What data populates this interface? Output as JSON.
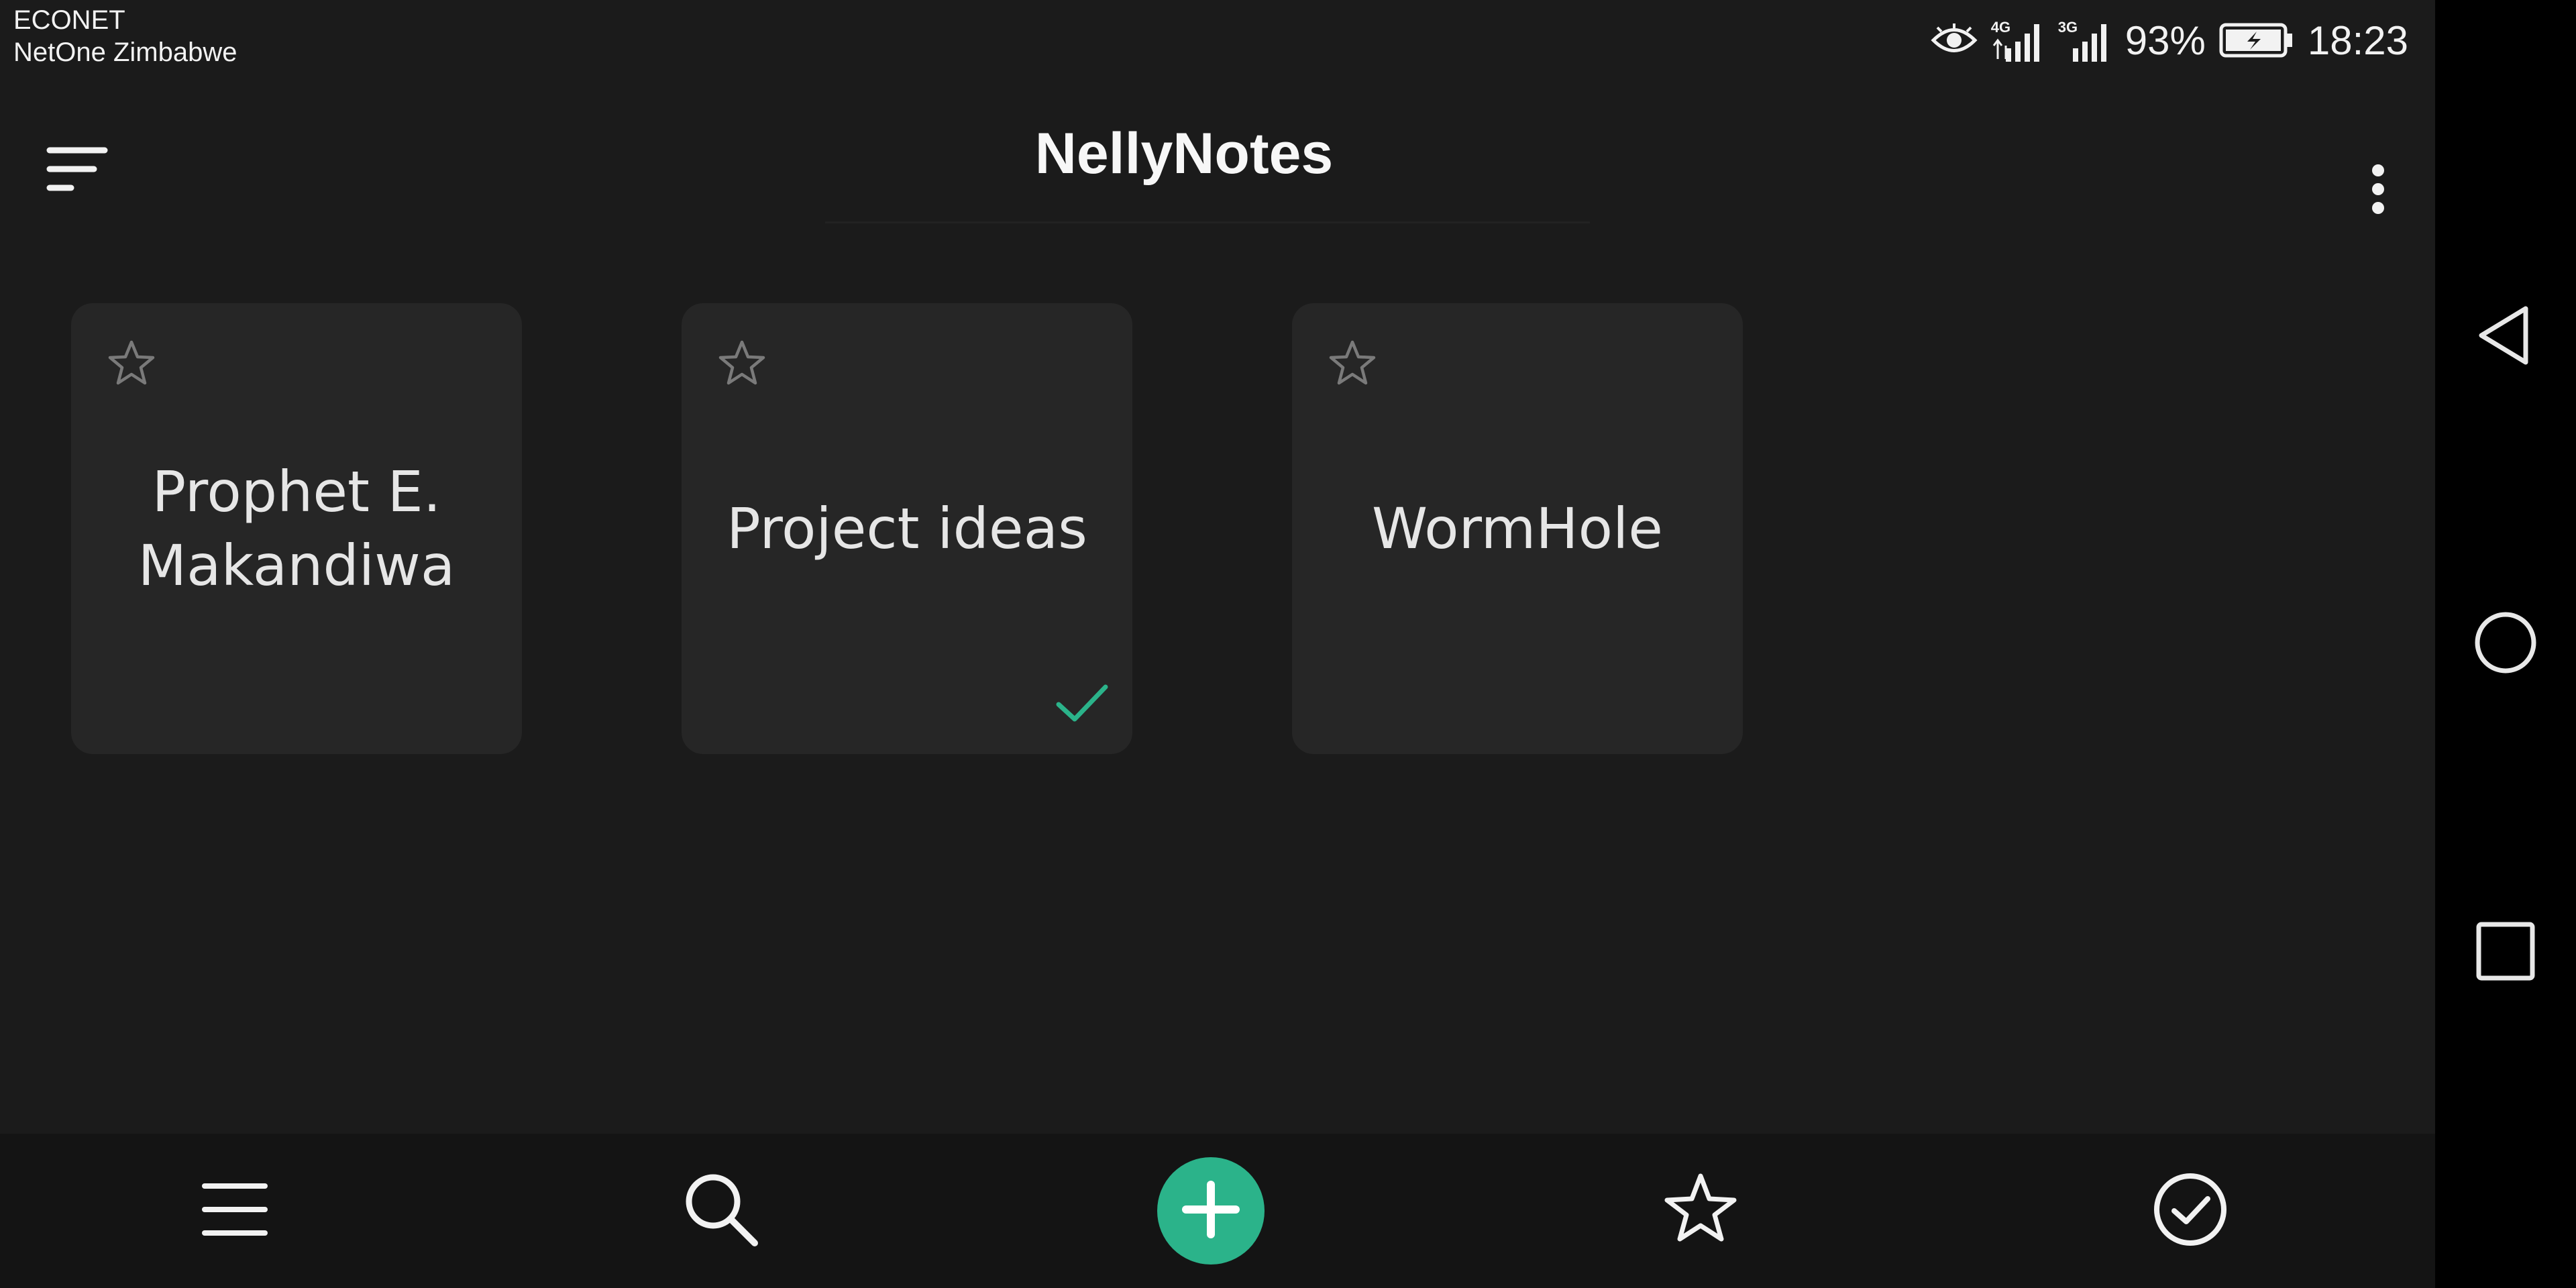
{
  "status_bar": {
    "carrier_primary": "ECONET",
    "carrier_secondary": "NetOne Zimbabwe",
    "network_1": "4G",
    "network_2": "3G",
    "battery": "93%",
    "time": "18:23",
    "icons": [
      "eye-icon",
      "signal-icon",
      "signal-icon",
      "battery-charging-icon"
    ]
  },
  "app_bar": {
    "title": "NellyNotes",
    "left_icon": "sort-menu-icon",
    "right_icon": "more-vertical-icon"
  },
  "notes": [
    {
      "title": "Prophet E. Makandiwa",
      "starred": false,
      "checked": false
    },
    {
      "title": "Project ideas",
      "starred": false,
      "checked": true
    },
    {
      "title": "WormHole",
      "starred": false,
      "checked": false
    }
  ],
  "bottom_bar": {
    "items": [
      "menu-icon",
      "search-icon",
      "add-icon",
      "star-icon",
      "check-circle-icon"
    ],
    "accent": "#2bb38a"
  },
  "nav_bar": {
    "items": [
      "back-icon",
      "home-icon",
      "recents-icon"
    ]
  },
  "colors": {
    "background": "#1b1b1b",
    "card": "#262626",
    "accent": "#2bb38a",
    "bottom_bar": "#141414"
  }
}
